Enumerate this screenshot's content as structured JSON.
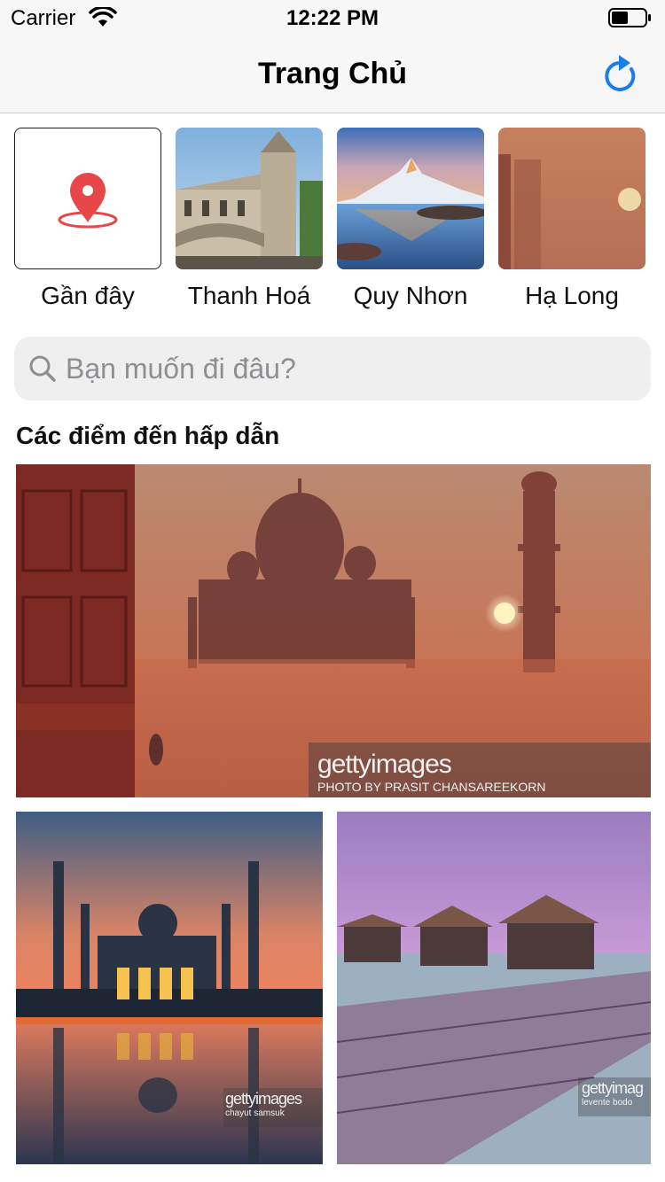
{
  "status_bar": {
    "carrier": "Carrier",
    "time": "12:22 PM"
  },
  "nav": {
    "title": "Trang Chủ",
    "refresh_icon": "refresh-icon"
  },
  "cities": [
    {
      "label": "Gần đây",
      "icon": "location-pin-icon"
    },
    {
      "label": "Thanh Hoá"
    },
    {
      "label": "Quy Nhơn"
    },
    {
      "label": "Hạ Long"
    }
  ],
  "search": {
    "placeholder": "Bạn muốn đi đâu?",
    "value": ""
  },
  "section": {
    "title": "Các điểm đến hấp dẫn"
  },
  "destinations": [
    {
      "watermark": "gettyimages",
      "credit": "PHOTO BY PRASIT CHANSAREEKORN"
    },
    {
      "watermark": "gettyimages",
      "credit": "chayut samsuk"
    },
    {
      "watermark": "gettyimag",
      "credit": "levente bodo"
    }
  ],
  "colors": {
    "accent": "#1a7ee8",
    "pin": "#e8474a"
  }
}
